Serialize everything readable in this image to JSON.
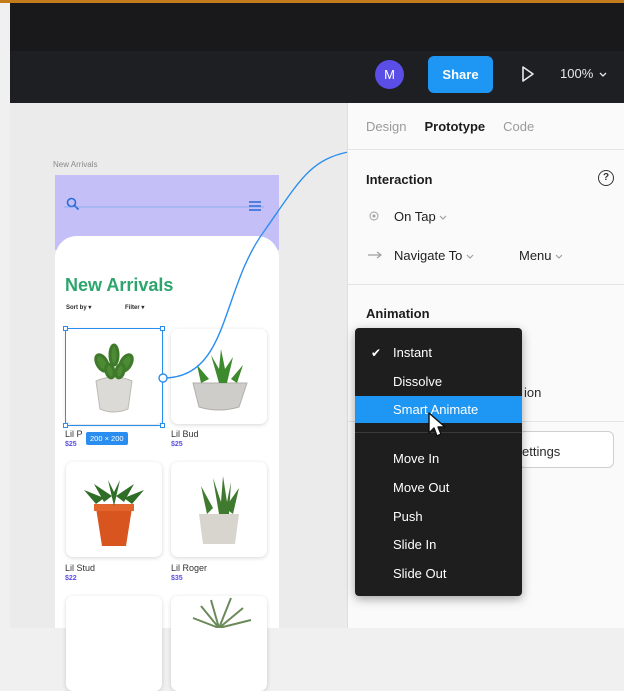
{
  "toolbar": {
    "avatar_initial": "M",
    "share_label": "Share",
    "zoom_label": "100%",
    "play_icon": "play-icon",
    "zoom_chevron_icon": "chevron-down-icon"
  },
  "canvas": {
    "frame_label": "New Arrivals",
    "app": {
      "title": "New Arrivals",
      "sort_label": "Sort by",
      "filter_label": "Filter",
      "products": [
        {
          "name": "Lil P",
          "price": "$25"
        },
        {
          "name": "Lil Bud",
          "price": "$25"
        },
        {
          "name": "Lil Stud",
          "price": "$22"
        },
        {
          "name": "Lil Roger",
          "price": "$35"
        }
      ],
      "selection_size": "200 × 200",
      "accent": "#2da56c",
      "header_color": "#c4bff7"
    }
  },
  "panel": {
    "tabs": [
      "Design",
      "Prototype",
      "Code"
    ],
    "interaction": {
      "title": "Interaction",
      "trigger": "On Tap",
      "action": "Navigate To",
      "destination": "Menu",
      "help_icon": "?"
    },
    "animation": {
      "title": "Animation",
      "partial_label": "ion",
      "settings_partial": "ettings"
    }
  },
  "dropdown": {
    "options": [
      "Instant",
      "Dissolve",
      "Smart Animate",
      "Move In",
      "Move Out",
      "Push",
      "Slide In",
      "Slide Out"
    ],
    "checked": "Instant",
    "highlighted": "Smart Animate",
    "highlight_color": "#1e96f4"
  }
}
